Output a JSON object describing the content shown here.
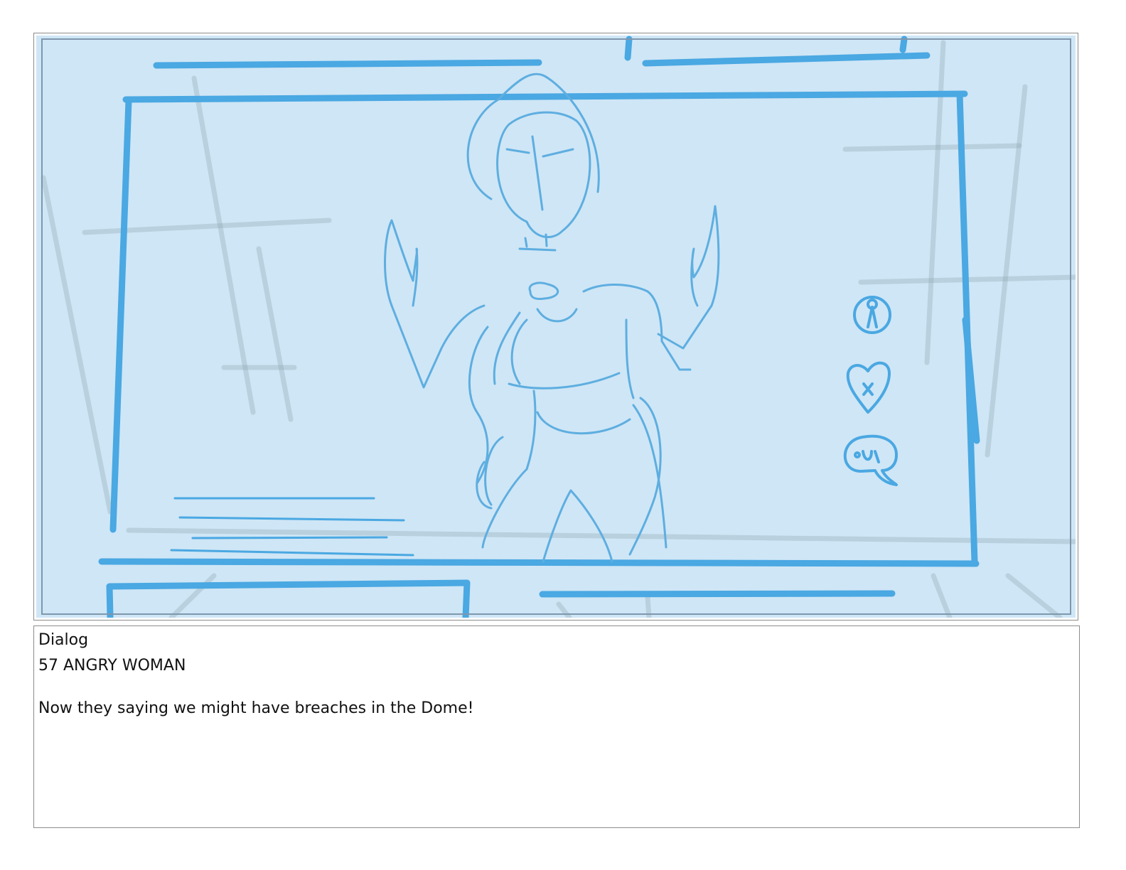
{
  "colors": {
    "panel_background": "#cfe6f6",
    "sketch_stroke": "#4aa8e2",
    "figure_stroke": "#5eaee0",
    "background_ghost_lines": "#8fa6b3",
    "frame_border": "#8c8c8c",
    "text": "#111111"
  },
  "panel": {
    "icons": [
      "person-icon",
      "heart-icon",
      "speech-bubble-icon"
    ]
  },
  "dialog": {
    "label": "Dialog",
    "character": "57 ANGRY WOMAN",
    "line": "Now they saying we might have breaches in the Dome!"
  }
}
